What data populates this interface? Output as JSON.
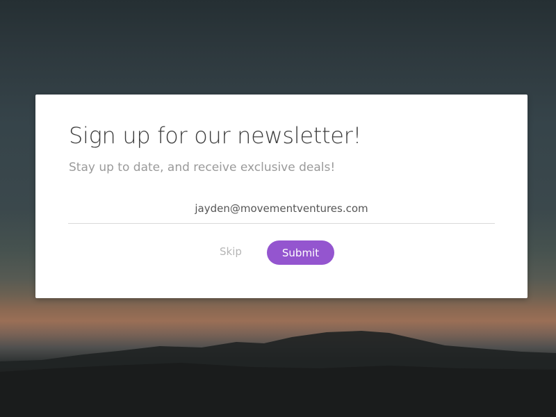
{
  "newsletter": {
    "title": "Sign up for our newsletter!",
    "subtitle": "Stay up to date, and receive exclusive deals!",
    "email_value": "jayden@movementventures.com",
    "skip_label": "Skip",
    "submit_label": "Submit"
  },
  "colors": {
    "accent": "#9455cf",
    "title": "#3c3c3c",
    "subtitle": "#9a9a9a",
    "skip": "#b5b5b5"
  }
}
